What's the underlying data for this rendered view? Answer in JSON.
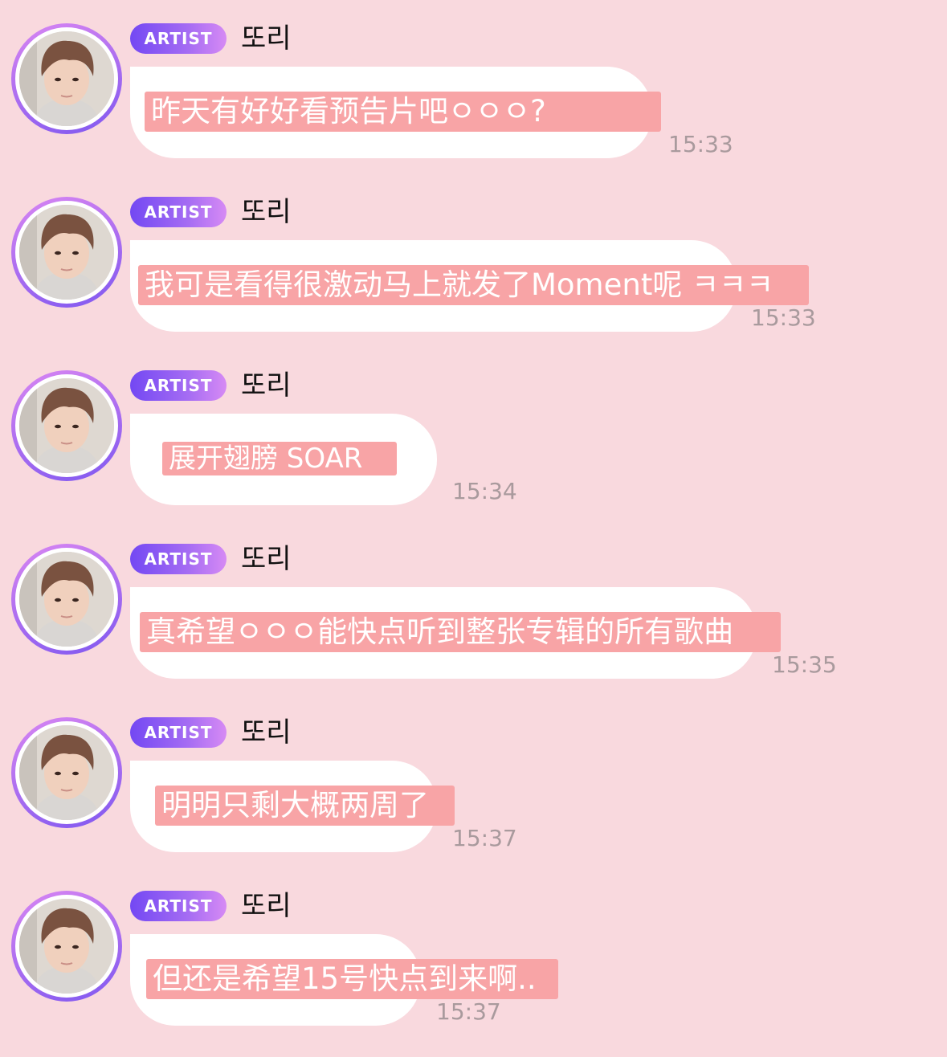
{
  "chat": {
    "messages": [
      {
        "badge": "ARTIST",
        "sender": "또리",
        "text": "昨天有好好看预告片吧ㅇㅇㅇ?",
        "time": "15:33"
      },
      {
        "badge": "ARTIST",
        "sender": "또리",
        "text": "我可是看得很激动马上就发了Moment呢 ㅋㅋㅋ",
        "time": "15:33"
      },
      {
        "badge": "ARTIST",
        "sender": "또리",
        "text": "展开翅膀 SOAR",
        "time": "15:34"
      },
      {
        "badge": "ARTIST",
        "sender": "또리",
        "text": "真希望ㅇㅇㅇ能快点听到整张专辑的所有歌曲",
        "time": "15:35"
      },
      {
        "badge": "ARTIST",
        "sender": "또리",
        "text": "明明只剩大概两周了",
        "time": "15:37"
      },
      {
        "badge": "ARTIST",
        "sender": "또리",
        "text": "但还是希望15号快点到来啊..",
        "time": "15:37"
      }
    ]
  },
  "colors": {
    "background": "#f9d9de",
    "bubble": "#ffffff",
    "highlight": "#f8a4a6",
    "badge_gradient_start": "#7348f3",
    "badge_gradient_end": "#d68af4",
    "time_text": "#a99a9d"
  },
  "icons": {
    "avatar": "profile-photo"
  }
}
